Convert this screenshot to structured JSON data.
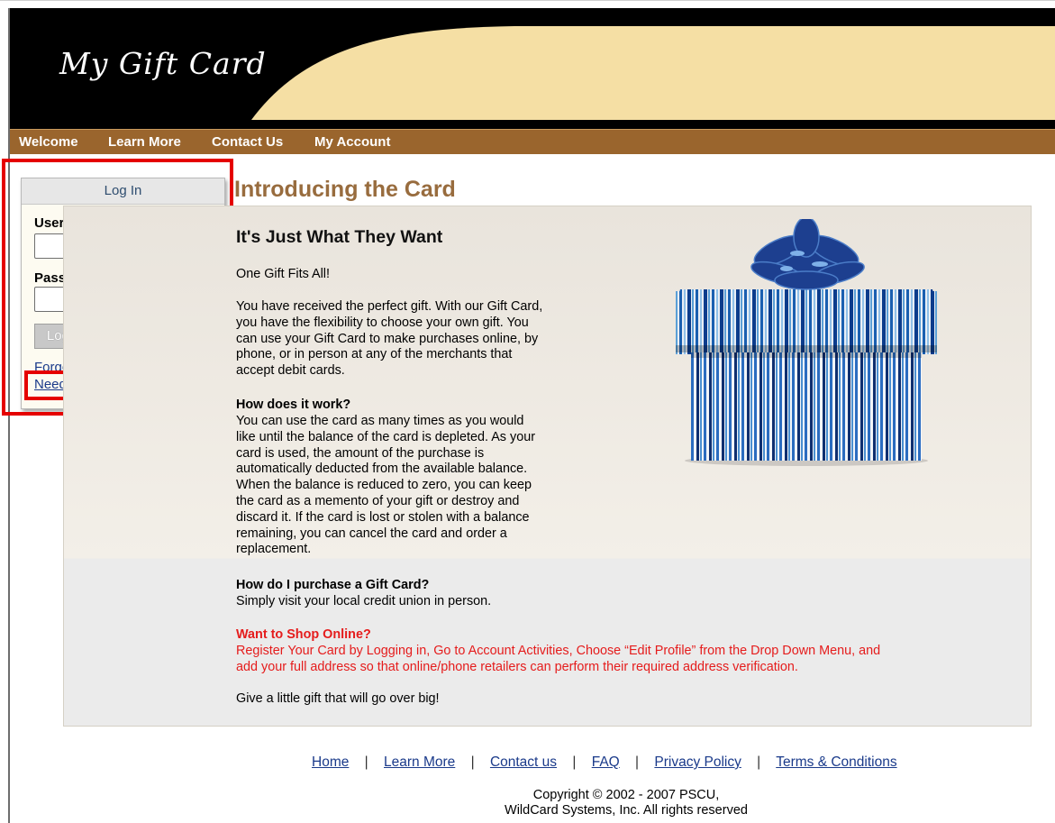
{
  "header": {
    "logo": "My Gift Card"
  },
  "nav": {
    "items": [
      "Welcome",
      "Learn More",
      "Contact Us",
      "My Account"
    ]
  },
  "login": {
    "title": "Log In",
    "username_label": "User Name*",
    "username_value": "",
    "password_label": "Password*",
    "password_value": "",
    "button": "Log In »",
    "forgot": "Forgot Your Login?",
    "need": "Need a Login?"
  },
  "main": {
    "title": "Introducing the Card",
    "subtitle": "It's Just What They Want",
    "tagline": "One Gift Fits All!",
    "intro": [
      "You have received the perfect gift. With our Gift Card,",
      "you have the flexibility to choose your own gift. You",
      "can use your Gift Card to make purchases online, by",
      "phone, or in person at any of the merchants that",
      "accept debit cards."
    ],
    "how_q": "How does it work?",
    "how_a": [
      "You can use the card as many times as you would",
      "like until the balance of the card is depleted. As your",
      "card is used, the amount of the purchase is",
      "automatically deducted from the available balance.",
      "When the balance is reduced to zero, you can keep",
      "the card as a memento of your gift or destroy and",
      "discard it. If the card is lost or stolen with a balance",
      "remaining, you can cancel the card and order a",
      "replacement."
    ],
    "purchase_q": "How do I purchase a Gift Card?",
    "purchase_a": "Simply visit your local credit union in person.",
    "shop_q": "Want to Shop Online?",
    "shop_a": [
      "Register Your Card by Logging in, Go to Account Activities, Choose “Edit Profile” from the Drop Down Menu, and",
      "add your full address so that online/phone retailers can perform their required address verification."
    ],
    "closing": "Give a little gift that will go over big!"
  },
  "footer": {
    "links": [
      "Home",
      "Learn More",
      "Contact us",
      "FAQ",
      "Privacy Policy",
      "Terms & Conditions"
    ],
    "separator": "|",
    "copyright": [
      "Copyright © 2002 - 2007 PSCU,",
      "WildCard Systems, Inc. All rights reserved"
    ]
  },
  "colors": {
    "nav_bg": "#9a652d",
    "header_bg": "#000000",
    "accent_gold": "#f5dfa4",
    "title_brown": "#986c3e",
    "highlight_red": "#e50000",
    "link_blue": "#1a3a8a"
  }
}
